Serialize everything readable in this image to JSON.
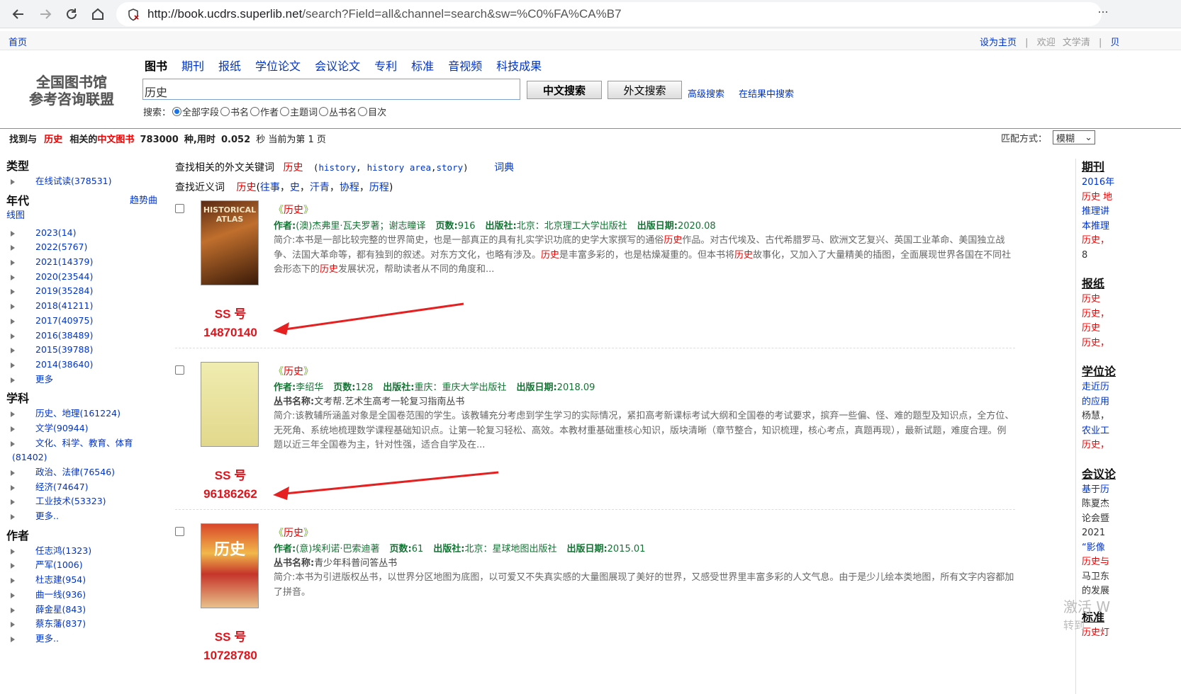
{
  "browser": {
    "url_host": "http://book.ucdrs.superlib.net",
    "url_path": "/search?Field=all&channel=search&sw=%C0%FA%CA%B7"
  },
  "topbar": {
    "home": "首页",
    "set_home": "设为主页",
    "sep": "|",
    "welcome": "欢迎",
    "user": "文学清",
    "sep2": "|",
    "tail": "贝"
  },
  "logo": {
    "line1": "全国图书馆",
    "line2": "参考咨询联盟"
  },
  "tabs": [
    "图书",
    "期刊",
    "报纸",
    "学位论文",
    "会议论文",
    "专利",
    "标准",
    "音视频",
    "科技成果"
  ],
  "search": {
    "query": "历史",
    "btn_cn": "中文搜索",
    "btn_foreign": "外文搜索",
    "advanced": "高级搜索",
    "in_results": "在结果中搜索",
    "field_label": "搜索：",
    "fields": [
      "全部字段",
      "书名",
      "作者",
      "主题词",
      "丛书名",
      "目次"
    ],
    "selected_field": "全部字段"
  },
  "summary": {
    "prefix": "找到与",
    "keyword": "历史",
    "mid": "相关的",
    "category": "中文图书",
    "count": "783000",
    "unit": "种,用时",
    "time": "0.052",
    "suffix": "秒 当前为第 1 页"
  },
  "match": {
    "label": "匹配方式：",
    "value": "模糊"
  },
  "left": {
    "type_title": "类型",
    "type_items": [
      "在线试读(378531)"
    ],
    "year_title": "年代",
    "trend_a": "趋势曲",
    "trend_b": "线图",
    "year_items": [
      "2023(14)",
      "2022(5767)",
      "2021(14379)",
      "2020(23544)",
      "2019(35284)",
      "2018(41211)",
      "2017(40975)",
      "2016(38489)",
      "2015(39788)",
      "2014(38640)",
      "更多"
    ],
    "subject_title": "学科",
    "subject_items": [
      "历史、地理(161224)",
      "文学(90944)",
      "文化、科学、教育、体育"
    ],
    "subject_wrap": "(81402)",
    "subject_items2": [
      "政治、法律(76546)",
      "经济(74647)",
      "工业技术(53323)",
      "更多.."
    ],
    "author_title": "作者",
    "author_items": [
      "任志鸿(1323)",
      "严军(1006)",
      "杜志建(954)",
      "曲一线(936)",
      "薛金星(843)",
      "蔡东藩(837)",
      "更多.."
    ]
  },
  "keywords": {
    "label": "查找相关的外文关键词",
    "word": "历史",
    "open": "(",
    "t1": "history",
    "c1": ",",
    "t2": "history area",
    "c2": ",",
    "t3": "story",
    "close": ")",
    "dict": "词典",
    "syn_label": "查找近义词",
    "syn_word": "历史",
    "syn_open": "(",
    "syn": [
      "往事",
      "史",
      "汗青",
      "协程",
      "历程"
    ],
    "syn_close": ")"
  },
  "results": [
    {
      "title": "历史",
      "author": "(澳)杰弗里·瓦夫罗著；谢志瞳译",
      "pages": "916",
      "publisher": "北京：北京理工大学出版社",
      "date": "2020.08",
      "abstract_a": "简介:本书是一部比较完整的世界简史，也是一部真正的具有扎实学识功底的史学大家撰写的通俗",
      "hl1": "历史",
      "abstract_b": "作品。对古代埃及、古代希腊罗马、欧洲文艺复兴、英国工业革命、美国独立战争、法国大革命等，都有独到的叙述。对东方文化，也略有涉及。",
      "hl2": "历史",
      "abstract_c": "是丰富多彩的，也是枯燥凝重的。但本书将",
      "hl3": "历史",
      "abstract_d": "故事化，又加入了大量精美的插图，全面展现世界各国在不同社会形态下的",
      "hl4": "历史",
      "abstract_e": "发展状况，帮助读者从不同的角度和...",
      "cover_text": "HISTORICAL ATLAS",
      "ss_label": "SS 号",
      "ss_no": "14870140"
    },
    {
      "title": "历史",
      "author": "李绍华",
      "pages": "128",
      "publisher": "重庆：重庆大学出版社",
      "date": "2018.09",
      "series": "文考帮.艺术生高考一轮复习指南丛书",
      "abstract": "简介:该教辅所涵盖对象是全国卷范围的学生。该教辅充分考虑到学生学习的实际情况，紧扣高考新课标考试大纲和全国卷的考试要求，摈弃一些偏、怪、难的题型及知识点，全方位、无死角、系统地梳理数学课程基础知识点。让第一轮复习轻松、高效。本教材重基础重核心知识，版块清晰（章节整合，知识梳理，核心考点，真题再现），最新试题，难度合理。例题以近三年全国卷为主，针对性强，适合自学及在...",
      "ss_label": "SS 号",
      "ss_no": "96186262"
    },
    {
      "title": "历史",
      "author": "(意)埃利诺·巴索迪著",
      "pages": "61",
      "publisher": "北京：星球地图出版社",
      "date": "2015.01",
      "series": "青少年科普问答丛书",
      "abstract": "简介:本书为引进版权丛书，以世界分区地图为底图，以可爱又不失真实感的大量图展现了美好的世界，又感受世界里丰富多彩的人文气息。由于是少儿绘本类地图，所有文字内容都加了拼音。",
      "cover_text": "历史",
      "ss_label": "SS 号",
      "ss_no": "10728780"
    }
  ],
  "labels": {
    "author": "作者:",
    "pages": "页数:",
    "publisher": "出版社:",
    "date": "出版日期:",
    "series": "丛书名称:",
    "q_open": "《",
    "q_close": "》"
  },
  "right": {
    "journal_title": "期刊",
    "journal_lines": [
      "2016年",
      "历史 地",
      "推理讲",
      "本推理",
      "历史，",
      "8"
    ],
    "news_title": "报纸",
    "news_lines": [
      "历史",
      "历史，",
      "历史",
      "历史，"
    ],
    "thesis_title": "学位论",
    "thesis_lines": [
      "走近历",
      "的应用",
      "杨慧，",
      "农业工",
      "历史，"
    ],
    "conf_title": "会议论",
    "conf_lines": [
      "基于历",
      "陈夏杰",
      "论会暨",
      "2021",
      "“影像",
      "历史与",
      "马卫东",
      "的发展"
    ],
    "std_title": "标准",
    "std_lines": [
      "历史灯"
    ]
  },
  "watermark": {
    "line1": "激活 W",
    "line2": "转到"
  }
}
